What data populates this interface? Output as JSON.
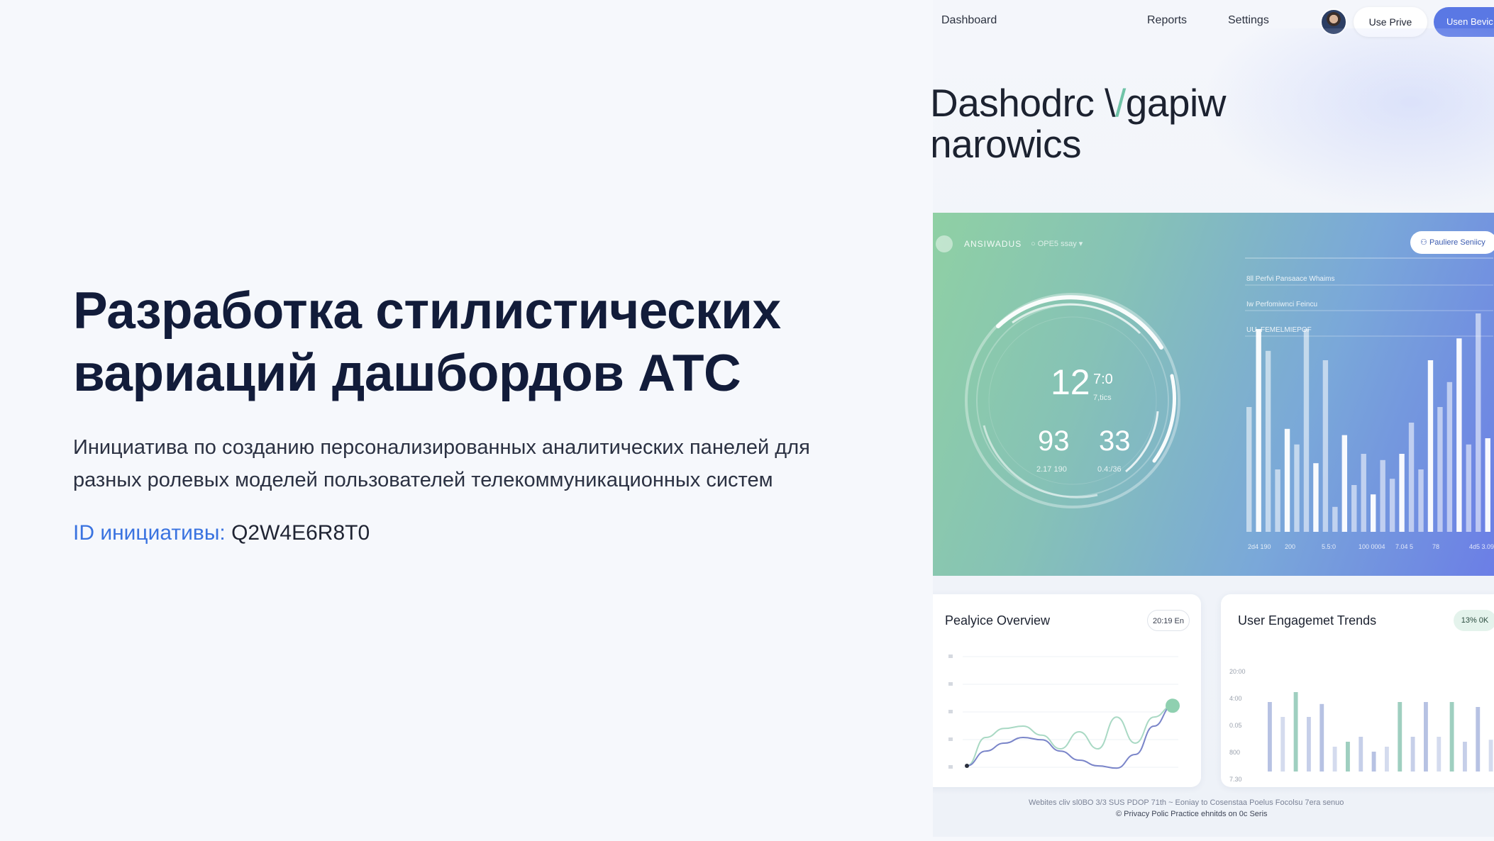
{
  "left": {
    "title_line1": "Разработка стилистических",
    "title_line2": "вариаций дашбордов АТС",
    "subtitle_line1": "Инициатива по созданию персонализированных аналитических панелей для",
    "subtitle_line2": "разных ролевых моделей пользователей телекоммуникационных систем",
    "id_label": "ID инициативы:",
    "id_value": "Q2W4E6R8T0"
  },
  "mockup": {
    "nav": {
      "dashboard": "Dashboard",
      "reports": "Reports",
      "settings": "Settings",
      "btn_light": "Use Prive",
      "btn_primary": "Usen Bevic"
    },
    "hero": {
      "line1_a": "Dashodrc \\",
      "line1_accent": "/",
      "line1_b": "gap",
      "line1_c": "iw",
      "line2": "narowics"
    },
    "band": {
      "label": "ANSIWADUS",
      "sub": "○ OPE5  ssay  ▾",
      "pill": "Pauliere Seniicy",
      "legend": [
        "8ll  Perfvi Pansaace   Whaims",
        "Iw   Perfomiwnci Feincu",
        "UU. FEMELMIEPOF"
      ],
      "gauge": {
        "main": "12",
        "main_sup": "7:0",
        "main_sub": "7,tics",
        "left": "93",
        "left_sub": "2.17 190",
        "right": "33",
        "right_sub": "0.4:/36"
      },
      "x_ticks": [
        "2d4  190",
        "200",
        "5.5:0",
        "100 0004",
        "7.04 5",
        "78",
        "4d5 3.090"
      ]
    },
    "card1": {
      "title": "Pealyice Overview",
      "chip": "20:19 En"
    },
    "card2": {
      "title": "User Engagemet Trends",
      "chip": "13% 0K",
      "y_ticks": [
        "20:00",
        "4:00",
        "0.05",
        "800",
        "7.30"
      ]
    },
    "footer": {
      "line1": "Webites cliv sl0BO  3/3 SUS PDOP  71th ~   Eoniay to Cosenstaa Poelus Focolsu   7era senuo",
      "line2": "© Privacy Polic   Practice   ehnitds on 0c Seris"
    }
  },
  "chart_data": [
    {
      "type": "bar",
      "title": "",
      "series": [
        {
          "values": [
            40,
            65,
            58,
            20,
            33,
            28,
            65,
            22,
            55,
            8,
            31,
            15,
            25,
            12,
            23,
            17,
            25,
            35,
            20,
            55,
            40,
            48,
            62,
            28,
            70,
            30
          ]
        }
      ],
      "x_ticks": [
        "2d4  190",
        "200",
        "5.5:0",
        "100 0004",
        "7.04 5",
        "78",
        "4d5 3.090"
      ]
    },
    {
      "type": "line",
      "title": "Pealyice Overview",
      "series": [
        {
          "values": [
            0.05,
            0.3,
            0.38,
            0.4,
            0.32,
            0.2,
            0.35,
            0.2,
            0.48,
            0.25,
            0.48,
            0.58
          ]
        },
        {
          "values": [
            0.05,
            0.18,
            0.25,
            0.3,
            0.28,
            0.18,
            0.1,
            0.05,
            0.03,
            0.15,
            0.4,
            0.58
          ]
        }
      ]
    },
    {
      "type": "bar",
      "title": "User Engagemet Trends",
      "y_ticks": [
        "20:00",
        "4:00",
        "0.05",
        "800",
        "7.30"
      ],
      "series": [
        {
          "values": [
            0.7,
            0.55,
            0.8,
            0.55,
            0.68,
            0.25,
            0.3,
            0.35,
            0.2,
            0.25,
            0.7,
            0.35,
            0.7,
            0.35,
            0.7,
            0.3,
            0.65,
            0.32
          ]
        }
      ]
    }
  ]
}
